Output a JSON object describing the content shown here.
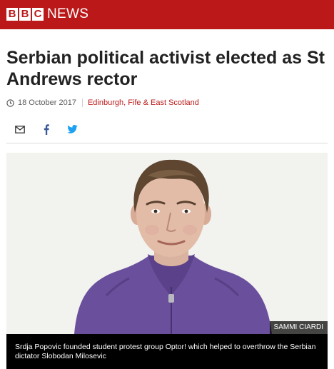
{
  "header": {
    "logo_letters": [
      "B",
      "B",
      "C"
    ],
    "section": "NEWS",
    "brand_color": "#bb1919"
  },
  "article": {
    "headline": "Serbian political activist elected as St Andrews rector",
    "date": "18 October 2017",
    "section_link": "Edinburgh, Fife & East Scotland"
  },
  "share": {
    "icons": [
      "email-icon",
      "facebook-icon",
      "twitter-icon"
    ]
  },
  "image": {
    "credit": "SAMMI CIARDI",
    "caption": "Srdja Popovic founded student protest group Optor! which helped to overthrow the Serbian dictator Slobodan Milosevic"
  },
  "colors": {
    "link": "#bb1919",
    "facebook": "#3b5998",
    "twitter": "#1da1f2"
  }
}
